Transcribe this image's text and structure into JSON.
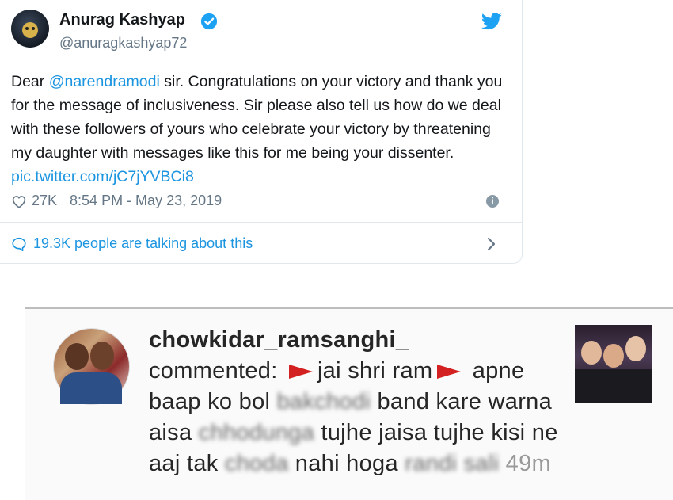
{
  "tweet": {
    "author_name": "Anurag Kashyap",
    "author_handle": "@anuragkashyap72",
    "text_before": "Dear ",
    "mention": "@narendramodi",
    "text_after": " sir. Congratulations on your victory and thank you for the message of inclusiveness. Sir please also tell us how do we deal with these followers of yours who celebrate your victory by threatening my daughter with messages like this for me being your dissenter. ",
    "pic_link": "pic.twitter.com/jC7jYVBCi8",
    "likes": "27K",
    "timestamp": "8:54 PM - May 23, 2019",
    "talking_text": "19.3K people are talking about this",
    "colors": {
      "link": "#1b95e0",
      "verified": "#1da1f2",
      "meta": "#657786"
    },
    "icons": [
      "verified-badge-icon",
      "twitter-bird-icon",
      "heart-icon",
      "info-icon",
      "speech-bubble-icon",
      "chevron-right-icon"
    ]
  },
  "instagram_comment": {
    "username": "chowkidar_ramsanghi_",
    "commented_label": "commented:",
    "seg1": "jai shri ram",
    "seg2": "apne baap ko bol",
    "blur1": "bakchodi",
    "seg3": "band kare warna aisa",
    "blur2": "chhodunga",
    "seg4": "tujhe jaisa tujhe kisi ne aaj tak",
    "blur3": "choda",
    "seg5": "nahi hoga",
    "blur4": "randi sali",
    "time_ago": "49m",
    "icons": [
      "flag-emoji-icon"
    ]
  }
}
